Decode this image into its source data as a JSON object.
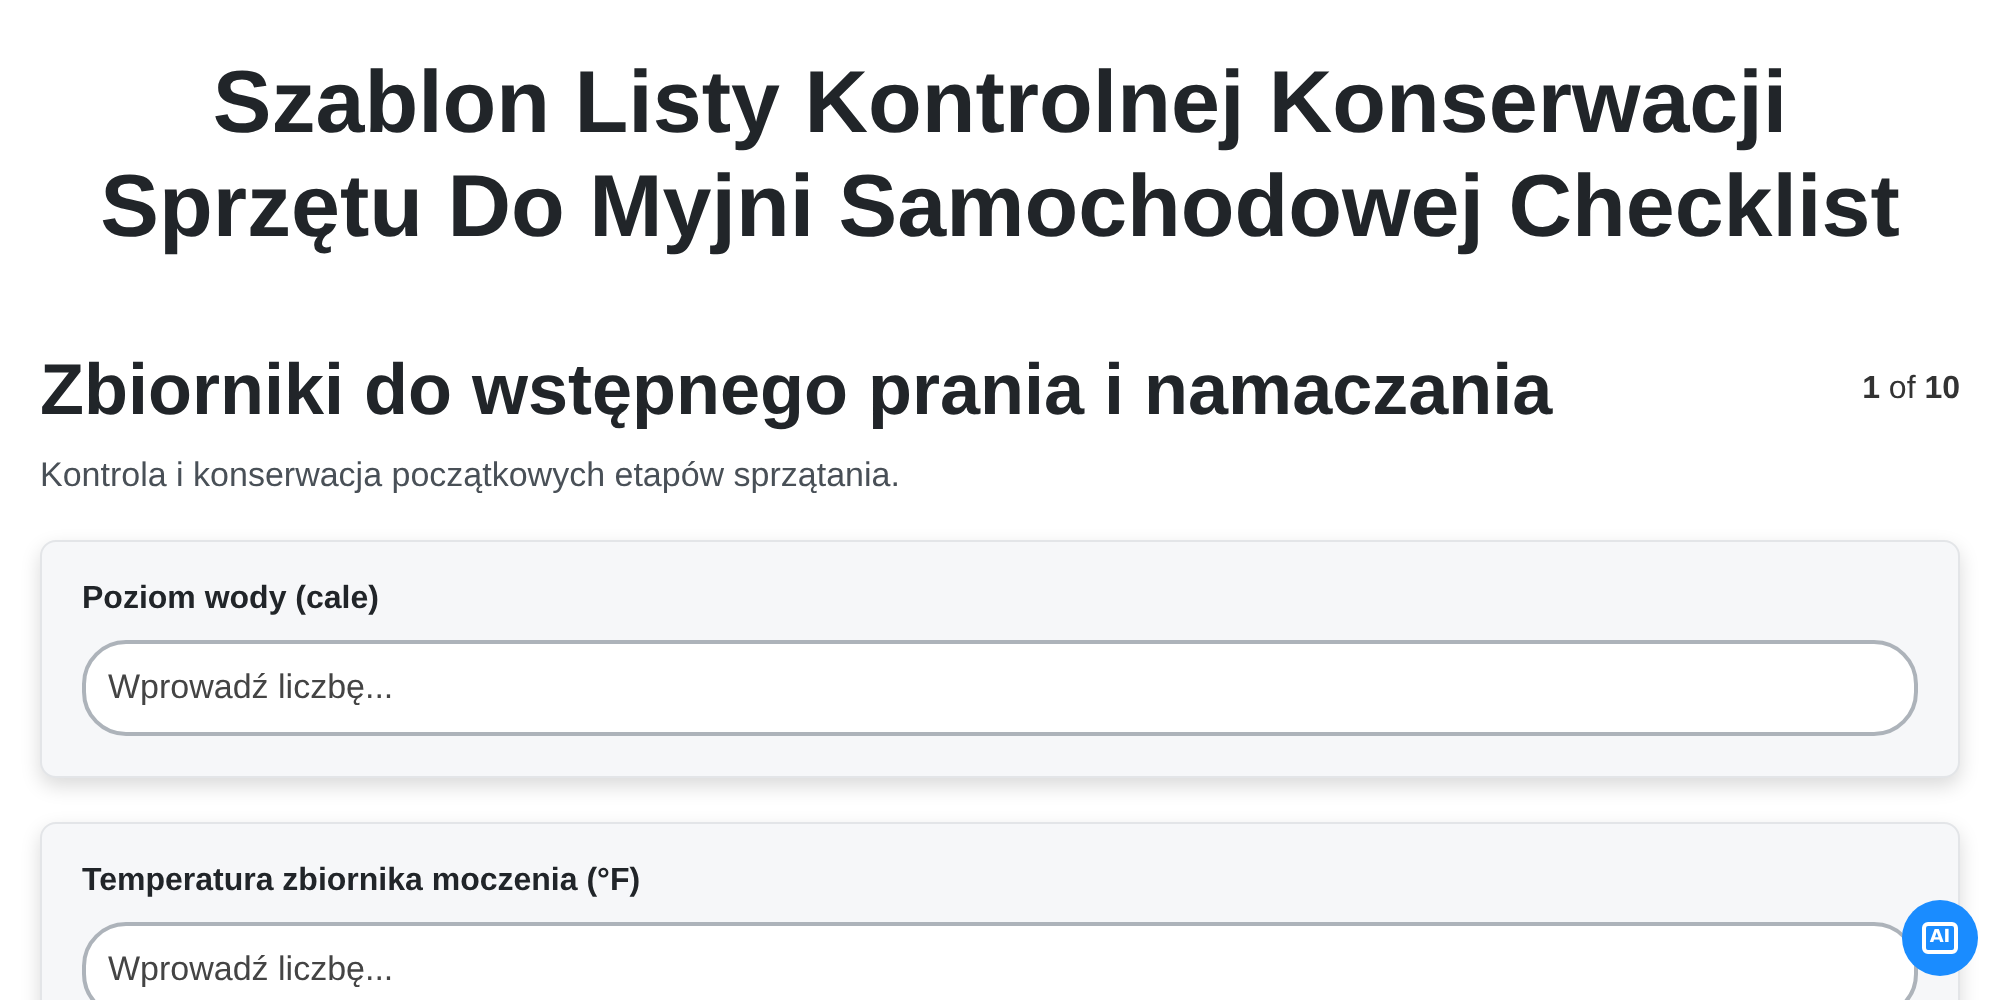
{
  "title": "Szablon Listy Kontrolnej Konserwacji Sprzętu Do Myjni Samochodowej Checklist",
  "section": {
    "heading": "Zbiorniki do wstępnego prania i namaczania",
    "counter": "**1** of **10**",
    "description": "Kontrola i konserwacja początkowych etapów sprzątania."
  },
  "fields": [
    {
      "label": "Poziom wody (cale)",
      "placeholder": "Wprowadź liczbę..."
    },
    {
      "label": "Temperatura zbiornika moczenia (°F)",
      "placeholder": "Wprowadź liczbę..."
    }
  ],
  "ai_button": {
    "label": "AI"
  }
}
